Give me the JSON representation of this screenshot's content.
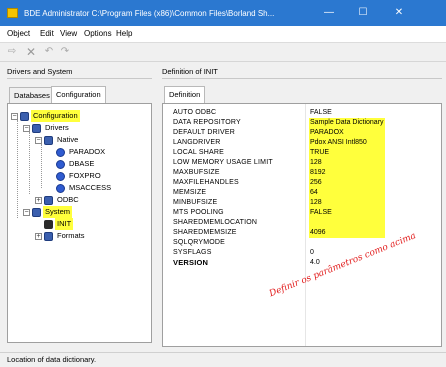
{
  "window": {
    "title": "BDE Administrator  C:\\Program Files (x86)\\Common Files\\Borland Sh...",
    "minimize": "—",
    "maximize": "☐",
    "close": "✕"
  },
  "menu": [
    "Object",
    "Edit",
    "View",
    "Options",
    "Help"
  ],
  "toolbar_icons": [
    "apply-icon",
    "delete-icon",
    "undo-icon",
    "redo-icon"
  ],
  "left_pane": {
    "header": "Drivers and System",
    "tabs": [
      "Databases",
      "Configuration"
    ],
    "active_tab": "Configuration",
    "tree": [
      {
        "label": "Configuration",
        "highlight": true
      },
      {
        "label": "Drivers",
        "highlight": false
      },
      {
        "label": "Native",
        "highlight": false
      },
      {
        "label": "PARADOX",
        "highlight": false
      },
      {
        "label": "DBASE",
        "highlight": false
      },
      {
        "label": "FOXPRO",
        "highlight": false
      },
      {
        "label": "MSACCESS",
        "highlight": false
      },
      {
        "label": "ODBC",
        "highlight": false
      },
      {
        "label": "System",
        "highlight": true
      },
      {
        "label": "INIT",
        "highlight": true
      },
      {
        "label": "Formats",
        "highlight": false
      }
    ]
  },
  "right_pane": {
    "header": "Definition of INIT",
    "tab": "Definition",
    "properties": [
      {
        "name": "AUTO ODBC",
        "value": "FALSE",
        "highlight": false,
        "bold": false
      },
      {
        "name": "DATA REPOSITORY",
        "value": "Sample Data Dictionary",
        "highlight": true,
        "bold": false
      },
      {
        "name": "DEFAULT DRIVER",
        "value": "PARADOX",
        "highlight": true,
        "bold": false
      },
      {
        "name": "LANGDRIVER",
        "value": "Pdox ANSI Intl850",
        "highlight": true,
        "bold": false
      },
      {
        "name": "LOCAL SHARE",
        "value": "TRUE",
        "highlight": true,
        "bold": false
      },
      {
        "name": "LOW MEMORY USAGE LIMIT",
        "value": "128",
        "highlight": true,
        "bold": false
      },
      {
        "name": "MAXBUFSIZE",
        "value": "8192",
        "highlight": true,
        "bold": false
      },
      {
        "name": "MAXFILEHANDLES",
        "value": "256",
        "highlight": true,
        "bold": false
      },
      {
        "name": "MEMSIZE",
        "value": "64",
        "highlight": true,
        "bold": false
      },
      {
        "name": "MINBUFSIZE",
        "value": "128",
        "highlight": true,
        "bold": false
      },
      {
        "name": "MTS POOLING",
        "value": "FALSE",
        "highlight": true,
        "bold": false
      },
      {
        "name": "SHAREDMEMLOCATION",
        "value": "",
        "highlight": true,
        "bold": false
      },
      {
        "name": "SHAREDMEMSIZE",
        "value": "4096",
        "highlight": true,
        "bold": false
      },
      {
        "name": "SQLQRYMODE",
        "value": "",
        "highlight": false,
        "bold": false
      },
      {
        "name": "SYSFLAGS",
        "value": "0",
        "highlight": false,
        "bold": false
      },
      {
        "name": "VERSION",
        "value": "4.0",
        "highlight": false,
        "bold": true
      }
    ]
  },
  "annotation": "Definir os parâmetros como acima",
  "status": "Location of data dictionary.",
  "colors": {
    "highlight": "#ffff3c",
    "titlebar": "#2b78d0",
    "annotation": "#e21b1b"
  }
}
